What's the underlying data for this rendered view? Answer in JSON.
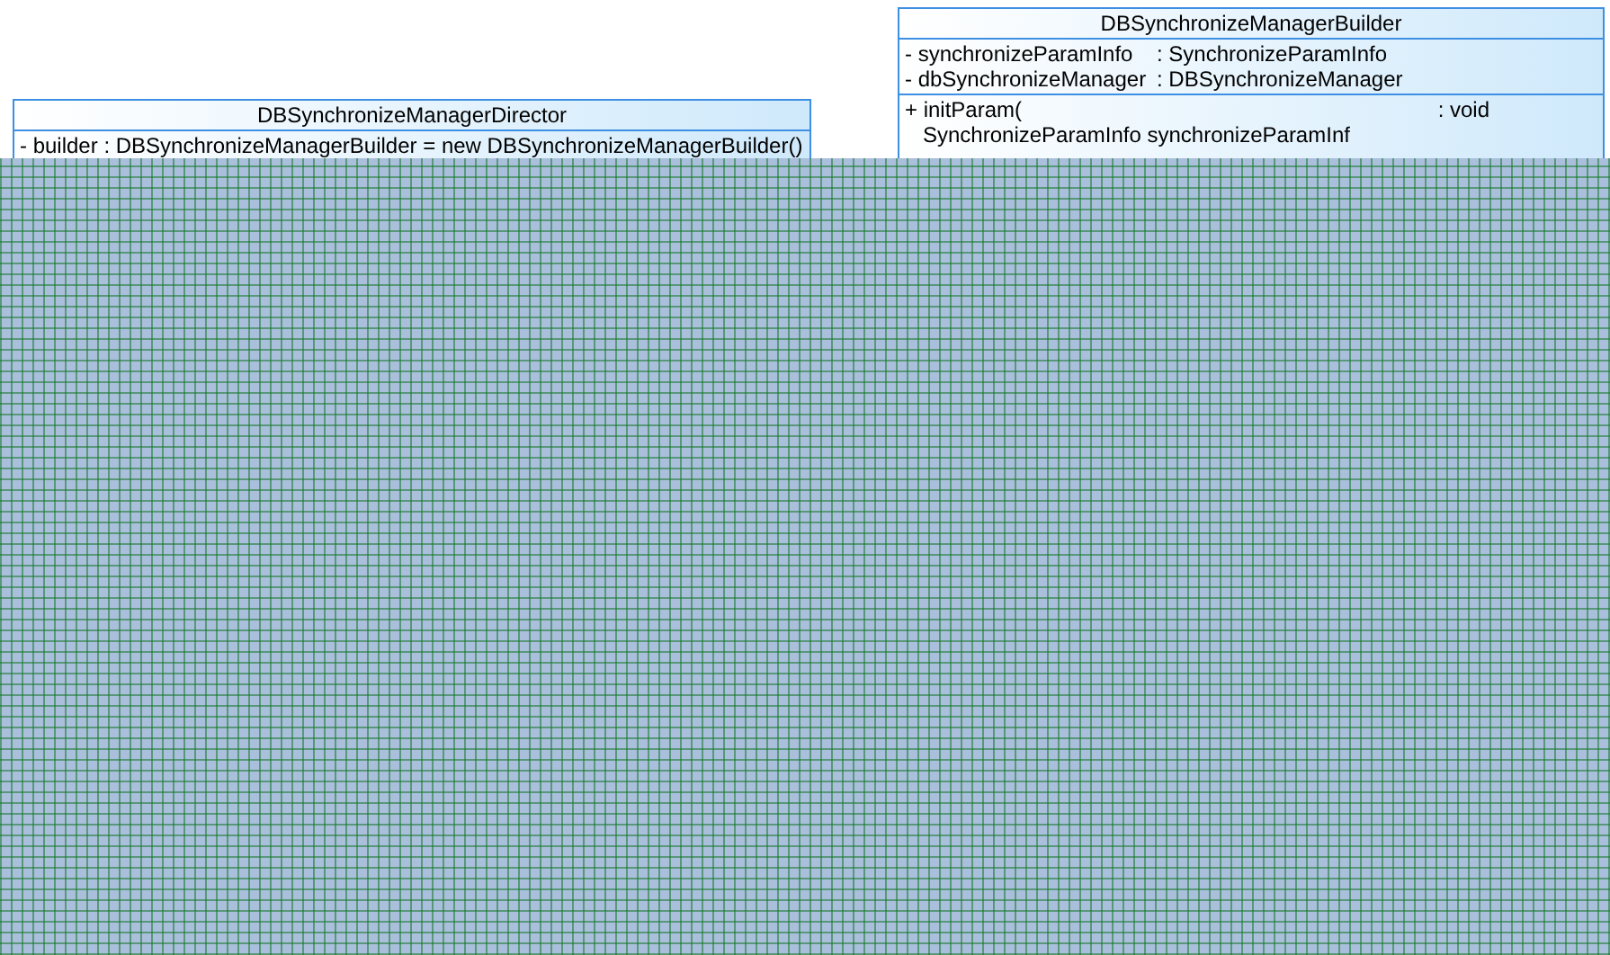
{
  "classes": [
    {
      "name": "DBSynchronizeManagerDirector",
      "attributes": [
        "- builder : DBSynchronizeManagerBuilder  = new DBSynchronizeManagerBuilder()"
      ]
    },
    {
      "name": "DBSynchronizeManagerBuilder",
      "attributes": [
        {
          "name": "- synchronizeParamInfo",
          "type": ": SynchronizeParamInfo"
        },
        {
          "name": "- dbSynchronizeManager",
          "type": ": DBSynchronizeManager"
        }
      ],
      "operations": [
        {
          "signature": "+ initParam(",
          "return_type": ": void",
          "parameter": "SynchronizeParamInfo synchronizeParamInf"
        }
      ]
    }
  ]
}
